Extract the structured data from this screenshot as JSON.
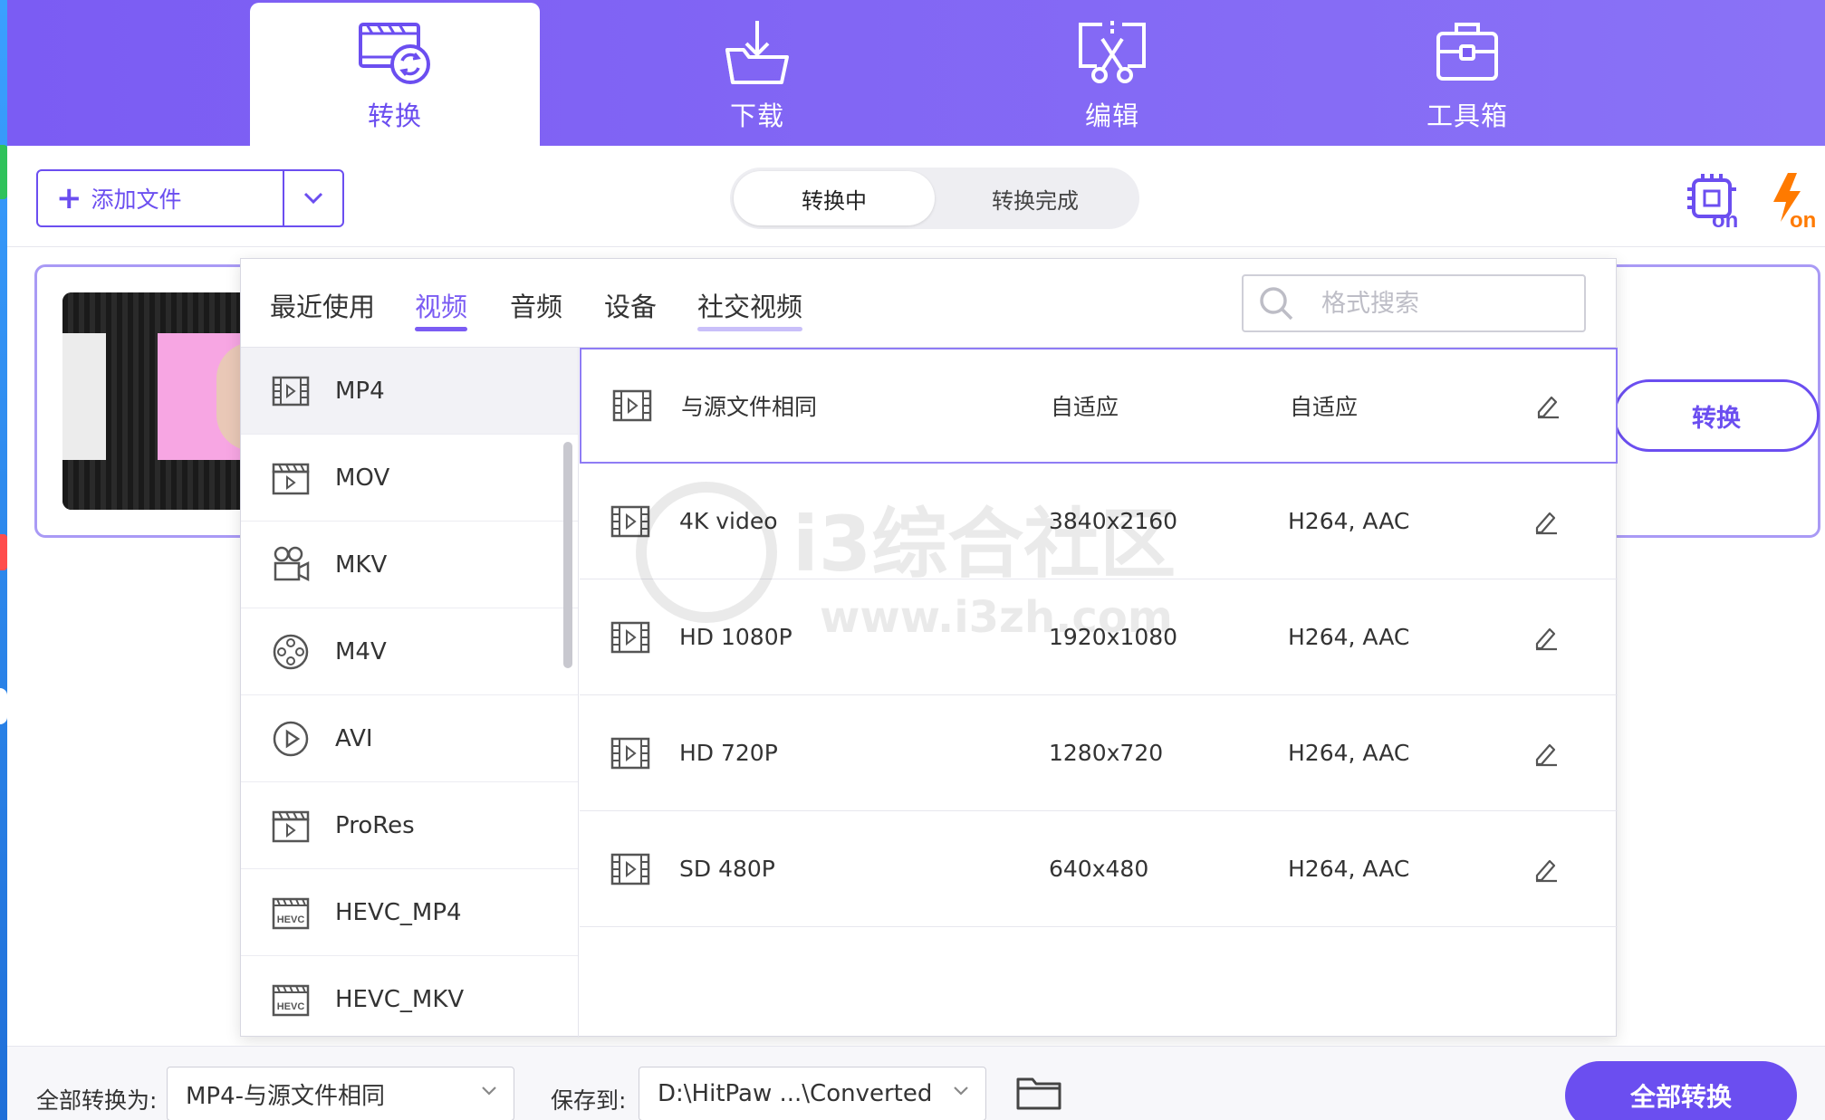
{
  "nav": {
    "tabs": [
      {
        "label": "转换",
        "icon": "convert-icon",
        "active": true
      },
      {
        "label": "下载",
        "icon": "download-icon",
        "active": false
      },
      {
        "label": "编辑",
        "icon": "edit-scissors-icon",
        "active": false
      },
      {
        "label": "工具箱",
        "icon": "toolbox-icon",
        "active": false
      }
    ]
  },
  "toolbar": {
    "add_file_label": "添加文件",
    "add_file_plus": "+",
    "segments": [
      {
        "label": "转换中",
        "active": true
      },
      {
        "label": "转换完成",
        "active": false
      }
    ],
    "hardware_accel": "on",
    "lightning": "on"
  },
  "file_card": {
    "convert_label": "转换"
  },
  "popup": {
    "tabs": [
      {
        "label": "最近使用",
        "active": false
      },
      {
        "label": "视频",
        "active": true
      },
      {
        "label": "音频",
        "active": false
      },
      {
        "label": "设备",
        "active": false
      },
      {
        "label": "社交视频",
        "active": false
      }
    ],
    "search_placeholder": "格式搜索",
    "formats": [
      {
        "name": "MP4",
        "icon": "film-icon",
        "selected": true
      },
      {
        "name": "MOV",
        "icon": "clapper-icon",
        "selected": false
      },
      {
        "name": "MKV",
        "icon": "camera-icon",
        "selected": false
      },
      {
        "name": "M4V",
        "icon": "reel-icon",
        "selected": false
      },
      {
        "name": "AVI",
        "icon": "play-circle-icon",
        "selected": false
      },
      {
        "name": "ProRes",
        "icon": "clapper-icon",
        "selected": false
      },
      {
        "name": "HEVC_MP4",
        "icon": "hevc-icon",
        "selected": false
      },
      {
        "name": "HEVC_MKV",
        "icon": "hevc-icon",
        "selected": false
      }
    ],
    "presets": [
      {
        "name": "与源文件相同",
        "resolution": "自适应",
        "codec": "自适应",
        "selected": true
      },
      {
        "name": "4K video",
        "resolution": "3840x2160",
        "codec": "H264, AAC",
        "selected": false
      },
      {
        "name": "HD 1080P",
        "resolution": "1920x1080",
        "codec": "H264, AAC",
        "selected": false
      },
      {
        "name": "HD 720P",
        "resolution": "1280x720",
        "codec": "H264, AAC",
        "selected": false
      },
      {
        "name": "SD 480P",
        "resolution": "640x480",
        "codec": "H264, AAC",
        "selected": false
      }
    ],
    "watermark_line1": "i3综合社区",
    "watermark_line2": "www.i3zh.com"
  },
  "bottom": {
    "convert_all_to_label": "全部转换为:",
    "convert_all_to_value": "MP4-与源文件相同",
    "save_to_label": "保存到:",
    "save_to_value": "D:\\HitPaw ...\\Converted",
    "convert_all_button": "全部转换"
  },
  "colors": {
    "accent": "#6b4ef0",
    "header": "#7b5cf3",
    "orange": "#ff7a00"
  }
}
